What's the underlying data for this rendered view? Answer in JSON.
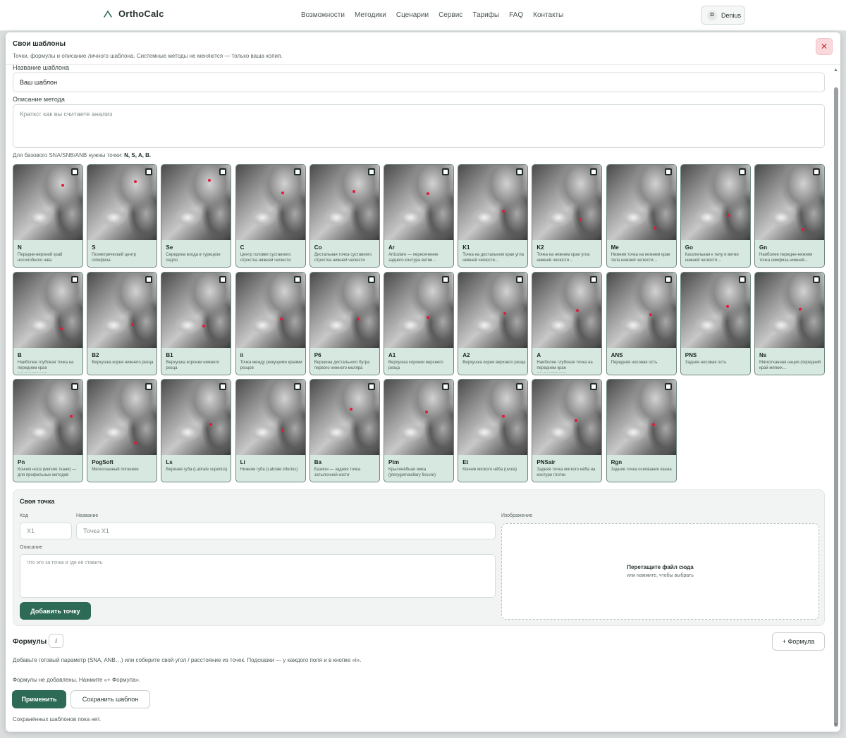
{
  "brand": {
    "name": "OrthoCalc"
  },
  "nav": [
    "Возможности",
    "Методики",
    "Сценарии",
    "Сервис",
    "Тарифы",
    "FAQ",
    "Контакты"
  ],
  "user": {
    "initial": "D",
    "name": "Denius"
  },
  "modal": {
    "title": "Свои шаблоны",
    "subtitle": "Точки, формулы и описание личного шаблона. Системные методы не меняются — только ваша копия.",
    "close_glyph": "✕"
  },
  "form": {
    "name_label": "Название шаблона",
    "name_value": "Ваш шаблон",
    "desc_label": "Описание метода",
    "desc_placeholder": "Кратко: как вы считаете анализ",
    "hint_prefix": "Для базового SNA/SNB/ANB нужны точки: ",
    "hint_points": "N, S, A, B."
  },
  "points": [
    {
      "code": "N",
      "desc": "Передне-верхний край носолобного шва"
    },
    {
      "code": "S",
      "desc": "Геометрический центр гипофиза"
    },
    {
      "code": "Se",
      "desc": "Середина входа в турецкое седло"
    },
    {
      "code": "C",
      "desc": "Центр головки суставного отростка нижней челюсти"
    },
    {
      "code": "Co",
      "desc": "Дистальная точка суставного отростка нижней челюсти"
    },
    {
      "code": "Ar",
      "desc": "Articulare — пересечение заднего контура ветви…"
    },
    {
      "code": "K1",
      "desc": "Точка на дистальном крае угла нижней челюсти…"
    },
    {
      "code": "K2",
      "desc": "Точка на нижнем крае угла нижней челюсти…"
    },
    {
      "code": "Me",
      "desc": "Нижняя точка на нижнем крае тела нижней челюсти…"
    },
    {
      "code": "Go",
      "desc": "Касательная к телу и ветви нижней челюсти…"
    },
    {
      "code": "Gn",
      "desc": "Наиболее передне-нижняя точка симфиза нижней…"
    },
    {
      "code": "B",
      "desc": "Наиболее глубокая точка на переднем крае альвеолярного…"
    },
    {
      "code": "B2",
      "desc": "Верхушка корня нижнего резца"
    },
    {
      "code": "B1",
      "desc": "Верхушка коронки нижнего резца"
    },
    {
      "code": "ii",
      "desc": "Точка между режущими краями резцов"
    },
    {
      "code": "P6",
      "desc": "Вершина дистального бугра первого нижнего моляра"
    },
    {
      "code": "A1",
      "desc": "Верхушка коронки верхнего резца"
    },
    {
      "code": "A2",
      "desc": "Верхушка корня верхнего резца"
    },
    {
      "code": "A",
      "desc": "Наиболее глубокая точка на переднем крае альвеолярного…"
    },
    {
      "code": "ANS",
      "desc": "Передняя носовая ость"
    },
    {
      "code": "PNS",
      "desc": "Задняя носовая ость"
    },
    {
      "code": "Ns",
      "desc": "Мягкотканная нация (передний край мягких…"
    },
    {
      "code": "Pn",
      "desc": "Кончик носа (мягкие ткани) — для профильных методов"
    },
    {
      "code": "PogSoft",
      "desc": "Мягкотканный погонион"
    },
    {
      "code": "Ls",
      "desc": "Верхняя губа (Labrale superius)"
    },
    {
      "code": "Li",
      "desc": "Нижняя губа (Labrale inferius)"
    },
    {
      "code": "Ba",
      "desc": "Базион — задняя точка затылочной кости"
    },
    {
      "code": "Ptm",
      "desc": "Крылонёбная ямка (pterygomaxillary fissure)"
    },
    {
      "code": "Et",
      "desc": "Кончик мягкого нёба (uvula)"
    },
    {
      "code": "PNSair",
      "desc": "Задняя точка мягкого нёба на контуре глотки"
    },
    {
      "code": "Rgn",
      "desc": "Задняя точка основания языка"
    }
  ],
  "own_point": {
    "title": "Своя точка",
    "code_label": "Код",
    "code_placeholder": "X1",
    "name_label": "Название",
    "name_placeholder": "Точка X1",
    "desc_label": "Описание",
    "desc_placeholder": "Что это за точка и где её ставить",
    "image_label": "Изображение",
    "drop_title": "Перетащите файл сюда",
    "drop_sub": "или нажмите, чтобы выбрать",
    "add_button": "Добавить точку"
  },
  "formulas": {
    "title": "Формулы",
    "info_glyph": "i",
    "add_button": "+ Формула",
    "help": "Добавьте готовый параметр (SNA, ANB…) или соберите свой угол / расстояние из точек. Подсказки — у каждого поля и в кнопке «i».",
    "empty": "Формулы не добавлены. Нажмите «+ Формула»."
  },
  "actions": {
    "apply": "Применить",
    "save": "Сохранить шаблон",
    "saved_empty": "Сохранённых шаблонов пока нет."
  },
  "colors": {
    "accent": "#2e6b57",
    "card_bg": "#d6e8df",
    "marker": "#e11a3a",
    "close_bg": "#f9d9dc"
  }
}
